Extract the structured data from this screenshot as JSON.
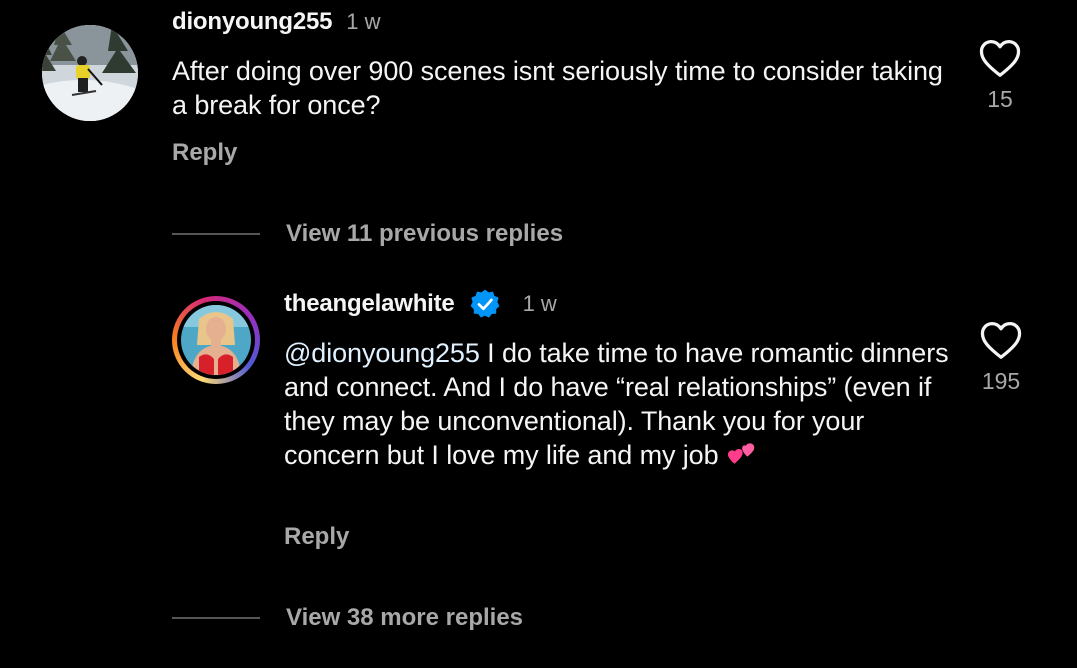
{
  "comments": [
    {
      "username": "dionyoung255",
      "time": "1 w",
      "text": "After doing over 900 scenes isnt seriously time to consider taking a break for once?",
      "likes": "15",
      "reply_label": "Reply"
    },
    {
      "username": "theangelawhite",
      "verified": true,
      "time": "1 w",
      "mention": "@dionyoung255",
      "text": " I do take time to have romantic dinners and connect. And I do have “real relationships” (even if they may be unconventional). Thank you for your concern but I love my life and my job ",
      "emoji": "two-hearts",
      "likes": "195",
      "reply_label": "Reply"
    }
  ],
  "view_previous_replies": "View 11 previous replies",
  "view_more_replies": "View 38 more replies",
  "colors": {
    "background": "#000000",
    "primary_text": "#f5f5f5",
    "secondary_text": "#a8a8a8",
    "verified_badge": "#0095f6"
  }
}
